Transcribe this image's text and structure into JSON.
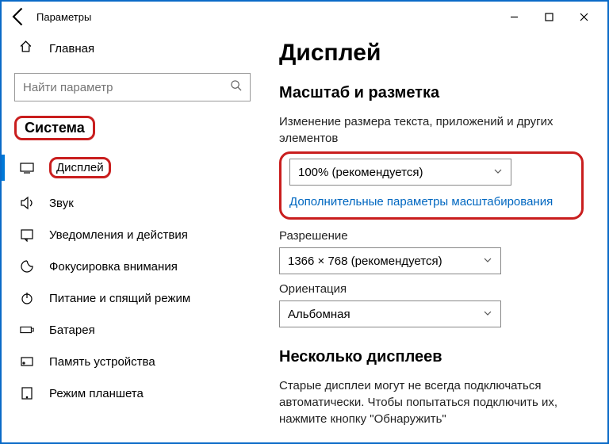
{
  "window": {
    "title": "Параметры"
  },
  "sidebar": {
    "home": "Главная",
    "search_placeholder": "Найти параметр",
    "section": "Система",
    "items": [
      {
        "label": "Дисплей"
      },
      {
        "label": "Звук"
      },
      {
        "label": "Уведомления и действия"
      },
      {
        "label": "Фокусировка внимания"
      },
      {
        "label": "Питание и спящий режим"
      },
      {
        "label": "Батарея"
      },
      {
        "label": "Память устройства"
      },
      {
        "label": "Режим планшета"
      }
    ]
  },
  "main": {
    "heading": "Дисплей",
    "scale_section": "Масштаб и разметка",
    "scale_label": "Изменение размера текста, приложений и других элементов",
    "scale_value": "100% (рекомендуется)",
    "scale_link": "Дополнительные параметры масштабирования",
    "resolution_label": "Разрешение",
    "resolution_value": "1366 × 768 (рекомендуется)",
    "orientation_label": "Ориентация",
    "orientation_value": "Альбомная",
    "multi_heading": "Несколько дисплеев",
    "multi_desc": "Старые дисплеи могут не всегда подключаться автоматически. Чтобы попытаться подключить их, нажмите кнопку \"Обнаружить\""
  }
}
